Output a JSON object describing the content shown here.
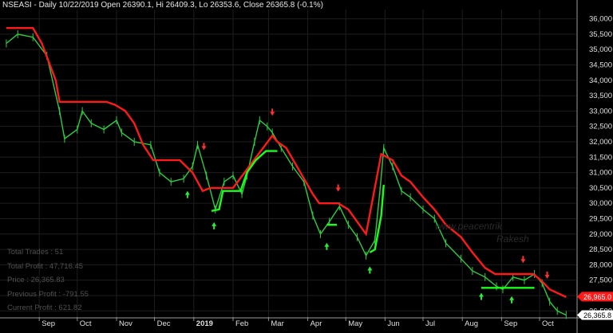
{
  "header": {
    "title": "NSEASI - Daily 10/22/2019 Open 26390.1, Hi 26409.3, Lo 26353.6, Close 26365.8 (-0.1%)"
  },
  "stats": [
    {
      "label": "Total Trades",
      "value": "51"
    },
    {
      "label": "Total Profit",
      "value": "47,716.45"
    },
    {
      "label": "Price",
      "value": "26,365.83"
    },
    {
      "label": "Previous Profit",
      "value": "-791.55"
    },
    {
      "label": "Current Profit",
      "value": "621.82"
    }
  ],
  "watermark": {
    "line1": "www.peacentrik",
    "line2": "Rakesh"
  },
  "chart_data": {
    "type": "line",
    "title": "NSEASI - Daily 10/22/2019 Open 26390.1, Hi 26409.3, Lo 26353.6, Close 26365.8 (-0.1%)",
    "ylim": [
      26300,
      36300
    ],
    "yticks": [
      26500,
      27000,
      27500,
      28000,
      28500,
      29000,
      29500,
      30000,
      30500,
      31000,
      31500,
      32000,
      32500,
      33000,
      33500,
      34000,
      34500,
      35000,
      35500,
      36000
    ],
    "ytick_labels": [
      "26,500",
      "27,000",
      "27,500",
      "28,000",
      "28,500",
      "29,000",
      "29,500",
      "30,000",
      "30,500",
      "31,000",
      "31,500",
      "32,000",
      "32,500",
      "33,000",
      "33,500",
      "34,000",
      "34,500",
      "35,000",
      "35,500",
      "36,000"
    ],
    "xlabels": [
      {
        "label": "Sep",
        "date": "2018-09-01"
      },
      {
        "label": "Oct",
        "date": "2018-10-01"
      },
      {
        "label": "Nov",
        "date": "2018-11-01"
      },
      {
        "label": "Dec",
        "date": "2018-12-01"
      },
      {
        "label": "2019",
        "date": "2019-01-01",
        "bold": true
      },
      {
        "label": "Feb",
        "date": "2019-02-01"
      },
      {
        "label": "Mar",
        "date": "2019-03-01"
      },
      {
        "label": "Apr",
        "date": "2019-04-01"
      },
      {
        "label": "May",
        "date": "2019-05-01"
      },
      {
        "label": "Jun",
        "date": "2019-06-01"
      },
      {
        "label": "Jul",
        "date": "2019-07-01"
      },
      {
        "label": "Aug",
        "date": "2019-08-01"
      },
      {
        "label": "Sep",
        "date": "2019-09-01"
      },
      {
        "label": "Oct",
        "date": "2019-10-01"
      }
    ],
    "series": [
      {
        "kind": "price",
        "color": "#2ecc40",
        "points": [
          [
            "2018-08-06",
            35200
          ],
          [
            "2018-08-15",
            35500
          ],
          [
            "2018-08-27",
            35400
          ],
          [
            "2018-09-07",
            34800
          ],
          [
            "2018-09-17",
            33000
          ],
          [
            "2018-09-21",
            32100
          ],
          [
            "2018-10-01",
            32400
          ],
          [
            "2018-10-05",
            33000
          ],
          [
            "2018-10-12",
            32600
          ],
          [
            "2018-10-22",
            32400
          ],
          [
            "2018-11-01",
            32700
          ],
          [
            "2018-11-05",
            32300
          ],
          [
            "2018-11-15",
            32000
          ],
          [
            "2018-11-28",
            31900
          ],
          [
            "2018-12-05",
            31000
          ],
          [
            "2018-12-14",
            30700
          ],
          [
            "2018-12-24",
            30800
          ],
          [
            "2018-12-31",
            31200
          ],
          [
            "2019-01-04",
            31900
          ],
          [
            "2019-01-11",
            30900
          ],
          [
            "2019-01-18",
            29800
          ],
          [
            "2019-01-25",
            30700
          ],
          [
            "2019-02-01",
            30900
          ],
          [
            "2019-02-08",
            30300
          ],
          [
            "2019-02-12",
            30900
          ],
          [
            "2019-02-18",
            32000
          ],
          [
            "2019-02-22",
            32700
          ],
          [
            "2019-02-28",
            32500
          ],
          [
            "2019-03-04",
            32300
          ],
          [
            "2019-03-11",
            31800
          ],
          [
            "2019-03-20",
            31200
          ],
          [
            "2019-03-29",
            30700
          ],
          [
            "2019-04-05",
            29600
          ],
          [
            "2019-04-11",
            29000
          ],
          [
            "2019-04-18",
            29400
          ],
          [
            "2019-04-26",
            29900
          ],
          [
            "2019-05-03",
            29300
          ],
          [
            "2019-05-10",
            28900
          ],
          [
            "2019-05-17",
            28300
          ],
          [
            "2019-05-24",
            28800
          ],
          [
            "2019-05-28",
            30400
          ],
          [
            "2019-05-31",
            31800
          ],
          [
            "2019-06-07",
            31200
          ],
          [
            "2019-06-14",
            30400
          ],
          [
            "2019-06-21",
            30200
          ],
          [
            "2019-07-01",
            29800
          ],
          [
            "2019-07-10",
            29500
          ],
          [
            "2019-07-19",
            28700
          ],
          [
            "2019-07-31",
            28200
          ],
          [
            "2019-08-09",
            27800
          ],
          [
            "2019-08-19",
            27600
          ],
          [
            "2019-08-28",
            27300
          ],
          [
            "2019-09-02",
            27200
          ],
          [
            "2019-09-10",
            27600
          ],
          [
            "2019-09-19",
            27500
          ],
          [
            "2019-09-27",
            27700
          ],
          [
            "2019-10-03",
            27400
          ],
          [
            "2019-10-09",
            26800
          ],
          [
            "2019-10-15",
            26500
          ],
          [
            "2019-10-22",
            26366
          ]
        ]
      },
      {
        "kind": "stop-short",
        "color": "#ff1a1a",
        "points": [
          [
            "2018-08-06",
            35700
          ],
          [
            "2018-08-27",
            35700
          ],
          [
            "2018-09-03",
            35200
          ],
          [
            "2018-09-14",
            34000
          ],
          [
            "2018-09-17",
            33300
          ],
          [
            "2018-10-24",
            33300
          ],
          [
            "2018-10-31",
            33200
          ],
          [
            "2018-11-08",
            33000
          ],
          [
            "2018-11-15",
            32600
          ],
          [
            "2018-11-22",
            31900
          ],
          [
            "2018-11-30",
            31400
          ],
          [
            "2018-12-21",
            31400
          ],
          [
            "2018-12-31",
            31000
          ],
          [
            "2019-01-08",
            30400
          ],
          [
            "2019-01-14",
            30500
          ],
          [
            "2019-02-01",
            30500
          ],
          [
            "2019-03-04",
            32200
          ],
          [
            "2019-03-08",
            32000
          ],
          [
            "2019-03-15",
            31800
          ],
          [
            "2019-03-22",
            31300
          ],
          [
            "2019-04-05",
            30300
          ],
          [
            "2019-04-10",
            30000
          ],
          [
            "2019-04-25",
            30000
          ],
          [
            "2019-05-03",
            29800
          ],
          [
            "2019-05-10",
            29400
          ],
          [
            "2019-05-17",
            29000
          ],
          [
            "2019-05-29",
            31600
          ],
          [
            "2019-06-07",
            31400
          ],
          [
            "2019-06-14",
            30900
          ],
          [
            "2019-06-21",
            30700
          ],
          [
            "2019-07-01",
            30200
          ],
          [
            "2019-07-10",
            29800
          ],
          [
            "2019-07-19",
            29300
          ],
          [
            "2019-07-31",
            28900
          ],
          [
            "2019-08-09",
            28400
          ],
          [
            "2019-08-19",
            27900
          ],
          [
            "2019-08-27",
            27700
          ],
          [
            "2019-09-18",
            27700
          ],
          [
            "2019-09-26",
            27700
          ],
          [
            "2019-10-02",
            27500
          ],
          [
            "2019-10-09",
            27200
          ],
          [
            "2019-10-22",
            26950
          ]
        ]
      },
      {
        "kind": "stop-long",
        "color": "#1aff1a",
        "points": [
          [
            "2019-01-15",
            29750
          ],
          [
            "2019-01-21",
            29800
          ],
          [
            "2019-01-24",
            30400
          ],
          [
            "2019-01-31",
            30400
          ],
          [
            "2019-02-07",
            30400
          ],
          [
            "2019-02-12",
            31000
          ],
          [
            "2019-02-19",
            31400
          ],
          [
            "2019-02-27",
            31700
          ],
          [
            "2019-03-08",
            31700
          ],
          [
            "2019-04-16",
            29300
          ],
          [
            "2019-04-24",
            29300
          ],
          [
            "2019-05-20",
            28400
          ],
          [
            "2019-05-24",
            28500
          ],
          [
            "2019-05-29",
            29600
          ],
          [
            "2019-05-31",
            30600
          ],
          [
            "2019-08-16",
            27250
          ],
          [
            "2019-08-23",
            27250
          ],
          [
            "2019-09-02",
            27250
          ],
          [
            "2019-09-10",
            27250
          ],
          [
            "2019-09-18",
            27250
          ],
          [
            "2019-09-27",
            27250
          ]
        ]
      }
    ],
    "buy_signals": [
      "2018-12-27",
      "2019-01-17",
      "2019-04-16",
      "2019-05-20",
      "2019-08-16",
      "2019-09-09"
    ],
    "sell_signals": [
      "2019-01-09",
      "2019-03-04",
      "2019-04-25",
      "2019-09-18",
      "2019-10-07"
    ],
    "last_values": [
      {
        "label": "26,965.0",
        "value": 26965,
        "color": "#ff1a1a"
      },
      {
        "label": "26,365.8",
        "value": 26366,
        "color": "#ffffff"
      }
    ],
    "grid": true,
    "colors": {
      "background": "#000000",
      "grid": "#1e1e1e",
      "up": "#2ecc40",
      "down": "#ff1a1a"
    }
  }
}
